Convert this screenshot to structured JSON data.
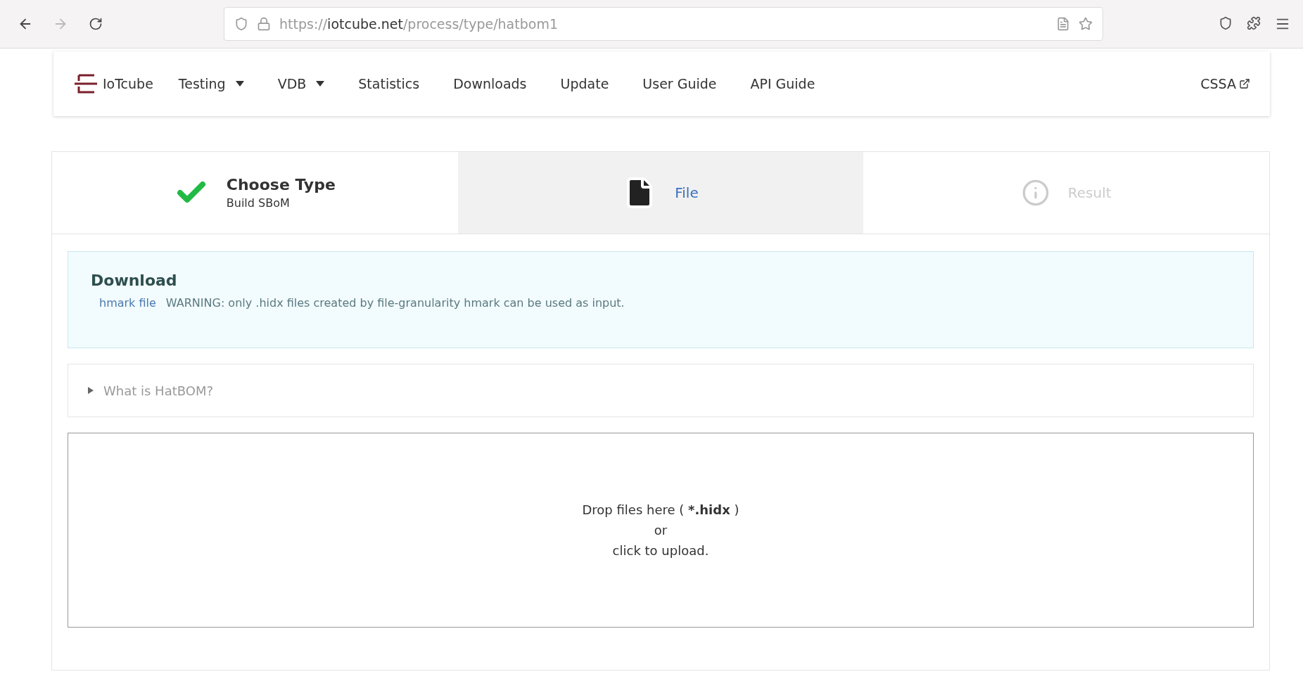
{
  "browser": {
    "url": {
      "scheme": "https://",
      "host": "iotcube.net",
      "path": "/process/type/hatbom1"
    }
  },
  "nav": {
    "brand": "IoTcube",
    "items": [
      {
        "label": "Testing",
        "dropdown": true
      },
      {
        "label": "VDB",
        "dropdown": true
      },
      {
        "label": "Statistics",
        "dropdown": false
      },
      {
        "label": "Downloads",
        "dropdown": false
      },
      {
        "label": "Update",
        "dropdown": false
      },
      {
        "label": "User Guide",
        "dropdown": false
      },
      {
        "label": "API Guide",
        "dropdown": false
      }
    ],
    "external": {
      "label": "CSSA"
    }
  },
  "steps": [
    {
      "kind": "completed",
      "title": "Choose Type",
      "description": "Build SBoM",
      "selected": false
    },
    {
      "kind": "file",
      "title": "File",
      "selected": true
    },
    {
      "kind": "info",
      "title": "Result",
      "selected": false,
      "disabled": true
    }
  ],
  "download": {
    "title": "Download",
    "link": "hmark file",
    "warning": "WARNING: only .hidx files created by file-granularity hmark can be used as input."
  },
  "accordion": {
    "title": "What is HatBOM?",
    "expanded": false
  },
  "dropzone": {
    "line1": {
      "before": "Drop files here (",
      "bold": "*.hidx",
      "after": ")"
    },
    "line2": "or",
    "line3": "click to upload."
  }
}
